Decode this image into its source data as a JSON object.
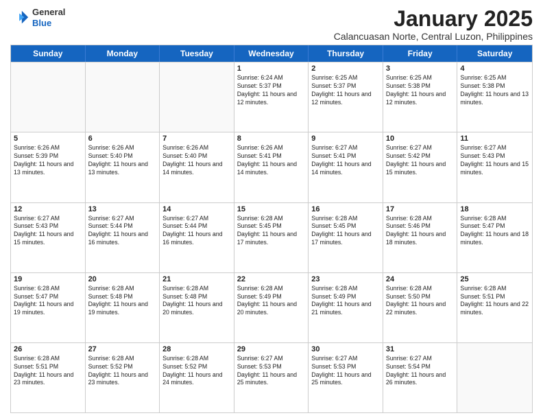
{
  "header": {
    "logo_line1": "General",
    "logo_line2": "Blue",
    "month": "January 2025",
    "location": "Calancuasan Norte, Central Luzon, Philippines"
  },
  "days_of_week": [
    "Sunday",
    "Monday",
    "Tuesday",
    "Wednesday",
    "Thursday",
    "Friday",
    "Saturday"
  ],
  "weeks": [
    [
      {
        "day": "",
        "empty": true
      },
      {
        "day": "",
        "empty": true
      },
      {
        "day": "",
        "empty": true
      },
      {
        "day": "1",
        "sunrise": "6:24 AM",
        "sunset": "5:37 PM",
        "daylight": "11 hours and 12 minutes."
      },
      {
        "day": "2",
        "sunrise": "6:25 AM",
        "sunset": "5:37 PM",
        "daylight": "11 hours and 12 minutes."
      },
      {
        "day": "3",
        "sunrise": "6:25 AM",
        "sunset": "5:38 PM",
        "daylight": "11 hours and 12 minutes."
      },
      {
        "day": "4",
        "sunrise": "6:25 AM",
        "sunset": "5:38 PM",
        "daylight": "11 hours and 13 minutes."
      }
    ],
    [
      {
        "day": "5",
        "sunrise": "6:26 AM",
        "sunset": "5:39 PM",
        "daylight": "11 hours and 13 minutes."
      },
      {
        "day": "6",
        "sunrise": "6:26 AM",
        "sunset": "5:40 PM",
        "daylight": "11 hours and 13 minutes."
      },
      {
        "day": "7",
        "sunrise": "6:26 AM",
        "sunset": "5:40 PM",
        "daylight": "11 hours and 14 minutes."
      },
      {
        "day": "8",
        "sunrise": "6:26 AM",
        "sunset": "5:41 PM",
        "daylight": "11 hours and 14 minutes."
      },
      {
        "day": "9",
        "sunrise": "6:27 AM",
        "sunset": "5:41 PM",
        "daylight": "11 hours and 14 minutes."
      },
      {
        "day": "10",
        "sunrise": "6:27 AM",
        "sunset": "5:42 PM",
        "daylight": "11 hours and 15 minutes."
      },
      {
        "day": "11",
        "sunrise": "6:27 AM",
        "sunset": "5:43 PM",
        "daylight": "11 hours and 15 minutes."
      }
    ],
    [
      {
        "day": "12",
        "sunrise": "6:27 AM",
        "sunset": "5:43 PM",
        "daylight": "11 hours and 15 minutes."
      },
      {
        "day": "13",
        "sunrise": "6:27 AM",
        "sunset": "5:44 PM",
        "daylight": "11 hours and 16 minutes."
      },
      {
        "day": "14",
        "sunrise": "6:27 AM",
        "sunset": "5:44 PM",
        "daylight": "11 hours and 16 minutes."
      },
      {
        "day": "15",
        "sunrise": "6:28 AM",
        "sunset": "5:45 PM",
        "daylight": "11 hours and 17 minutes."
      },
      {
        "day": "16",
        "sunrise": "6:28 AM",
        "sunset": "5:45 PM",
        "daylight": "11 hours and 17 minutes."
      },
      {
        "day": "17",
        "sunrise": "6:28 AM",
        "sunset": "5:46 PM",
        "daylight": "11 hours and 18 minutes."
      },
      {
        "day": "18",
        "sunrise": "6:28 AM",
        "sunset": "5:47 PM",
        "daylight": "11 hours and 18 minutes."
      }
    ],
    [
      {
        "day": "19",
        "sunrise": "6:28 AM",
        "sunset": "5:47 PM",
        "daylight": "11 hours and 19 minutes."
      },
      {
        "day": "20",
        "sunrise": "6:28 AM",
        "sunset": "5:48 PM",
        "daylight": "11 hours and 19 minutes."
      },
      {
        "day": "21",
        "sunrise": "6:28 AM",
        "sunset": "5:48 PM",
        "daylight": "11 hours and 20 minutes."
      },
      {
        "day": "22",
        "sunrise": "6:28 AM",
        "sunset": "5:49 PM",
        "daylight": "11 hours and 20 minutes."
      },
      {
        "day": "23",
        "sunrise": "6:28 AM",
        "sunset": "5:49 PM",
        "daylight": "11 hours and 21 minutes."
      },
      {
        "day": "24",
        "sunrise": "6:28 AM",
        "sunset": "5:50 PM",
        "daylight": "11 hours and 22 minutes."
      },
      {
        "day": "25",
        "sunrise": "6:28 AM",
        "sunset": "5:51 PM",
        "daylight": "11 hours and 22 minutes."
      }
    ],
    [
      {
        "day": "26",
        "sunrise": "6:28 AM",
        "sunset": "5:51 PM",
        "daylight": "11 hours and 23 minutes."
      },
      {
        "day": "27",
        "sunrise": "6:28 AM",
        "sunset": "5:52 PM",
        "daylight": "11 hours and 23 minutes."
      },
      {
        "day": "28",
        "sunrise": "6:28 AM",
        "sunset": "5:52 PM",
        "daylight": "11 hours and 24 minutes."
      },
      {
        "day": "29",
        "sunrise": "6:27 AM",
        "sunset": "5:53 PM",
        "daylight": "11 hours and 25 minutes."
      },
      {
        "day": "30",
        "sunrise": "6:27 AM",
        "sunset": "5:53 PM",
        "daylight": "11 hours and 25 minutes."
      },
      {
        "day": "31",
        "sunrise": "6:27 AM",
        "sunset": "5:54 PM",
        "daylight": "11 hours and 26 minutes."
      },
      {
        "day": "",
        "empty": true
      }
    ]
  ]
}
